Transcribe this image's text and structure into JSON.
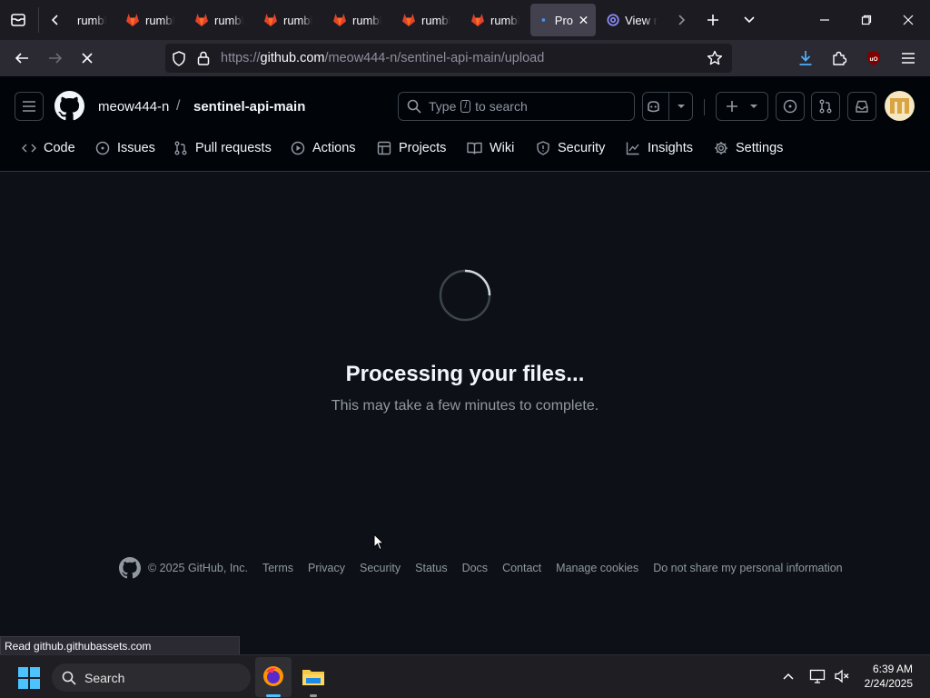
{
  "browser": {
    "tabs": [
      {
        "label": "rumble",
        "icon": "gitlab-icon"
      },
      {
        "label": "rumble",
        "icon": "gitlab-icon"
      },
      {
        "label": "rumble",
        "icon": "gitlab-icon"
      },
      {
        "label": "rumble",
        "icon": "gitlab-icon"
      },
      {
        "label": "rumble",
        "icon": "gitlab-icon"
      },
      {
        "label": "rumble",
        "icon": "gitlab-icon"
      },
      {
        "label": "rumble",
        "icon": "gitlab-icon"
      }
    ],
    "active_tab": {
      "label": "Pro"
    },
    "next_tab": {
      "label": "View r"
    },
    "url_prefix": "https://",
    "url_host": "github.com",
    "url_path": "/meow444-n/sentinel-api-main/upload"
  },
  "github": {
    "owner": "meow444-n",
    "separator": "/",
    "repo": "sentinel-api-main",
    "search_pre": "Type",
    "search_key": "/",
    "search_post": "to search",
    "repo_tabs": [
      "Code",
      "Issues",
      "Pull requests",
      "Actions",
      "Projects",
      "Wiki",
      "Security",
      "Insights",
      "Settings"
    ]
  },
  "main": {
    "title": "Processing your files...",
    "subtitle": "This may take a few minutes to complete."
  },
  "footer": {
    "copyright": "© 2025 GitHub, Inc.",
    "links": [
      "Terms",
      "Privacy",
      "Security",
      "Status",
      "Docs",
      "Contact",
      "Manage cookies",
      "Do not share my personal information"
    ]
  },
  "status_text": "Read github.githubassets.com",
  "taskbar": {
    "search_label": "Search",
    "time": "6:39 AM",
    "date": "2/24/2025"
  },
  "colors": {
    "page_bg": "#0d1117",
    "header_bg": "#010409",
    "gitlab_orange": "#e2432a",
    "accent_blue": "#4493f8"
  }
}
